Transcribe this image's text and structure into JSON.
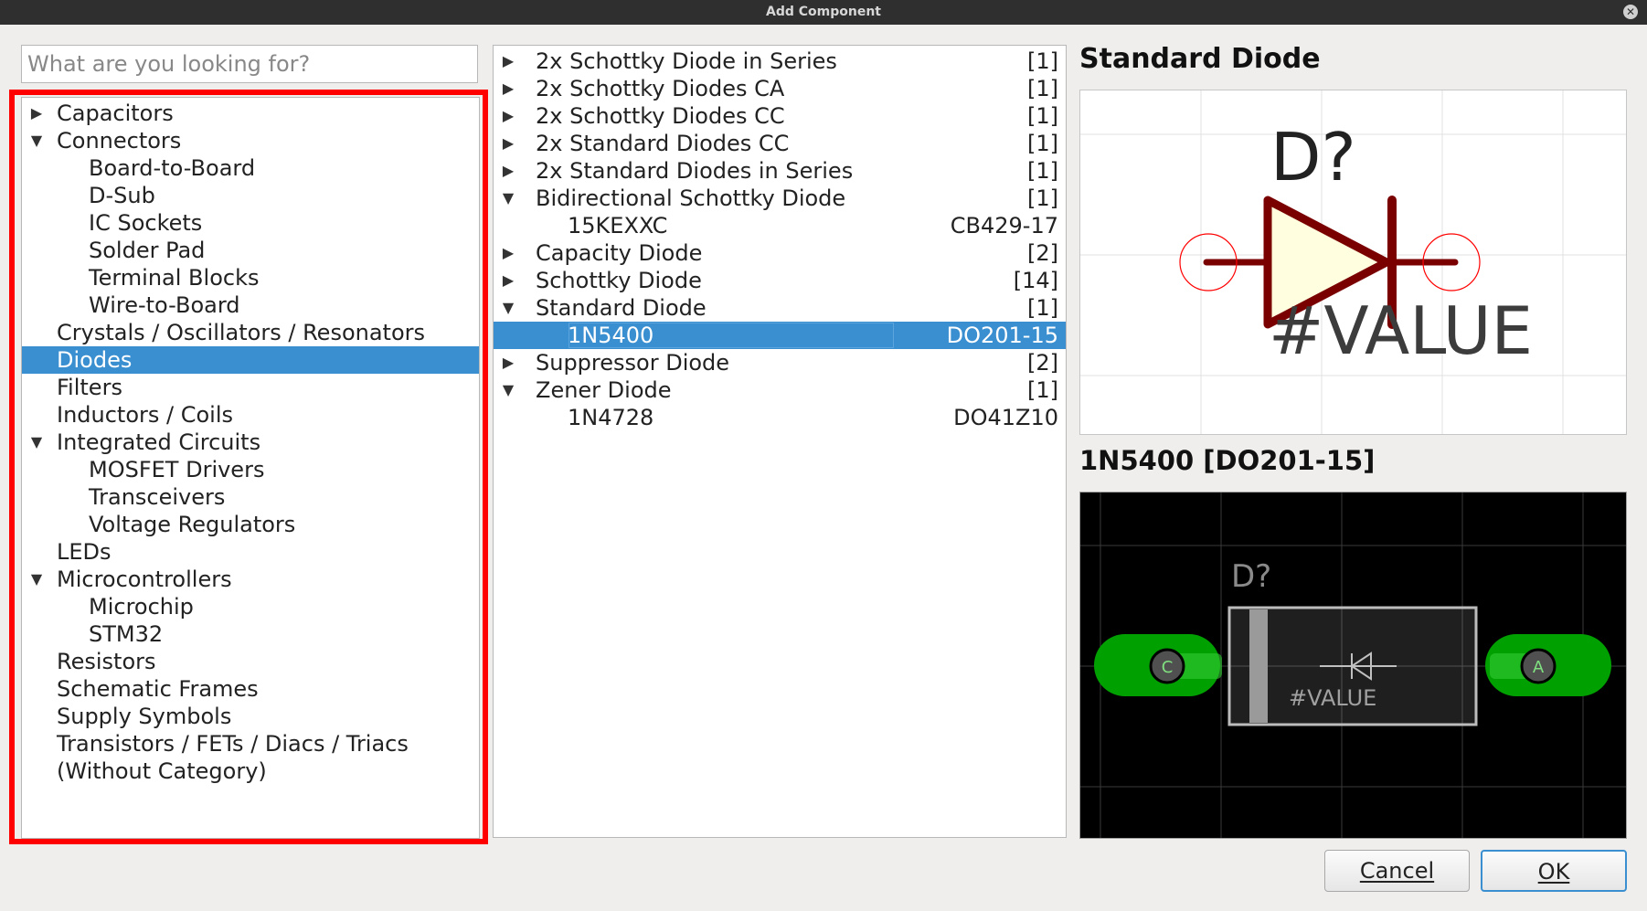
{
  "window": {
    "title": "Add Component"
  },
  "search": {
    "placeholder": "What are you looking for?",
    "value": ""
  },
  "categories": [
    {
      "label": "Capacitors",
      "level": 0,
      "expanded": false,
      "selected": false
    },
    {
      "label": "Connectors",
      "level": 0,
      "expanded": true,
      "selected": false
    },
    {
      "label": "Board-to-Board",
      "level": 1,
      "selected": false
    },
    {
      "label": "D-Sub",
      "level": 1,
      "selected": false
    },
    {
      "label": "IC Sockets",
      "level": 1,
      "selected": false
    },
    {
      "label": "Solder Pad",
      "level": 1,
      "selected": false
    },
    {
      "label": "Terminal Blocks",
      "level": 1,
      "selected": false
    },
    {
      "label": "Wire-to-Board",
      "level": 1,
      "selected": false
    },
    {
      "label": "Crystals / Oscillators / Resonators",
      "level": 0,
      "selected": false
    },
    {
      "label": "Diodes",
      "level": 0,
      "selected": true
    },
    {
      "label": "Filters",
      "level": 0,
      "selected": false
    },
    {
      "label": "Inductors / Coils",
      "level": 0,
      "selected": false
    },
    {
      "label": "Integrated Circuits",
      "level": 0,
      "expanded": true,
      "selected": false
    },
    {
      "label": "MOSFET Drivers",
      "level": 1,
      "selected": false
    },
    {
      "label": "Transceivers",
      "level": 1,
      "selected": false
    },
    {
      "label": "Voltage Regulators",
      "level": 1,
      "selected": false
    },
    {
      "label": "LEDs",
      "level": 0,
      "selected": false
    },
    {
      "label": "Microcontrollers",
      "level": 0,
      "expanded": true,
      "selected": false
    },
    {
      "label": "Microchip",
      "level": 1,
      "selected": false
    },
    {
      "label": "STM32",
      "level": 1,
      "selected": false
    },
    {
      "label": "Resistors",
      "level": 0,
      "selected": false
    },
    {
      "label": "Schematic Frames",
      "level": 0,
      "selected": false
    },
    {
      "label": "Supply Symbols",
      "level": 0,
      "selected": false
    },
    {
      "label": "Transistors / FETs / Diacs / Triacs",
      "level": 0,
      "selected": false
    },
    {
      "label": "(Without Category)",
      "level": 0,
      "selected": false
    }
  ],
  "components": [
    {
      "label": "2x Schottky Diode in Series",
      "right": "[1]",
      "level": 0,
      "expanded": false
    },
    {
      "label": "2x Schottky Diodes CA",
      "right": "[1]",
      "level": 0,
      "expanded": false
    },
    {
      "label": "2x Schottky Diodes CC",
      "right": "[1]",
      "level": 0,
      "expanded": false
    },
    {
      "label": "2x Standard Diodes CC",
      "right": "[1]",
      "level": 0,
      "expanded": false
    },
    {
      "label": "2x Standard Diodes in Series",
      "right": "[1]",
      "level": 0,
      "expanded": false
    },
    {
      "label": "Bidirectional Schottky Diode",
      "right": "[1]",
      "level": 0,
      "expanded": true
    },
    {
      "label": "15KEXXC",
      "right": "CB429-17",
      "level": 1
    },
    {
      "label": "Capacity Diode",
      "right": "[2]",
      "level": 0,
      "expanded": false
    },
    {
      "label": "Schottky Diode",
      "right": "[14]",
      "level": 0,
      "expanded": false
    },
    {
      "label": "Standard Diode",
      "right": "[1]",
      "level": 0,
      "expanded": true
    },
    {
      "label": "1N5400",
      "right": "DO201-15",
      "level": 1,
      "selected": true
    },
    {
      "label": "Suppressor Diode",
      "right": "[2]",
      "level": 0,
      "expanded": false
    },
    {
      "label": "Zener Diode",
      "right": "[1]",
      "level": 0,
      "expanded": true
    },
    {
      "label": "1N4728",
      "right": "DO41Z10",
      "level": 1
    }
  ],
  "preview": {
    "symbol_title": "Standard Diode",
    "symbol_name": "D?",
    "symbol_value": "#VALUE",
    "footprint_title": "1N5400 [DO201-15]",
    "footprint_name": "D?",
    "footprint_value": "#VALUE",
    "pad_left": "C",
    "pad_right": "A"
  },
  "buttons": {
    "cancel": "Cancel",
    "ok": "OK"
  },
  "colors": {
    "selection": "#3a8fd0",
    "highlight_frame": "#ff0000",
    "symbol_stroke": "#7a0000",
    "symbol_fill": "#ffffe0",
    "pin_circle": "#ff0000",
    "pad_green": "#00a000"
  }
}
